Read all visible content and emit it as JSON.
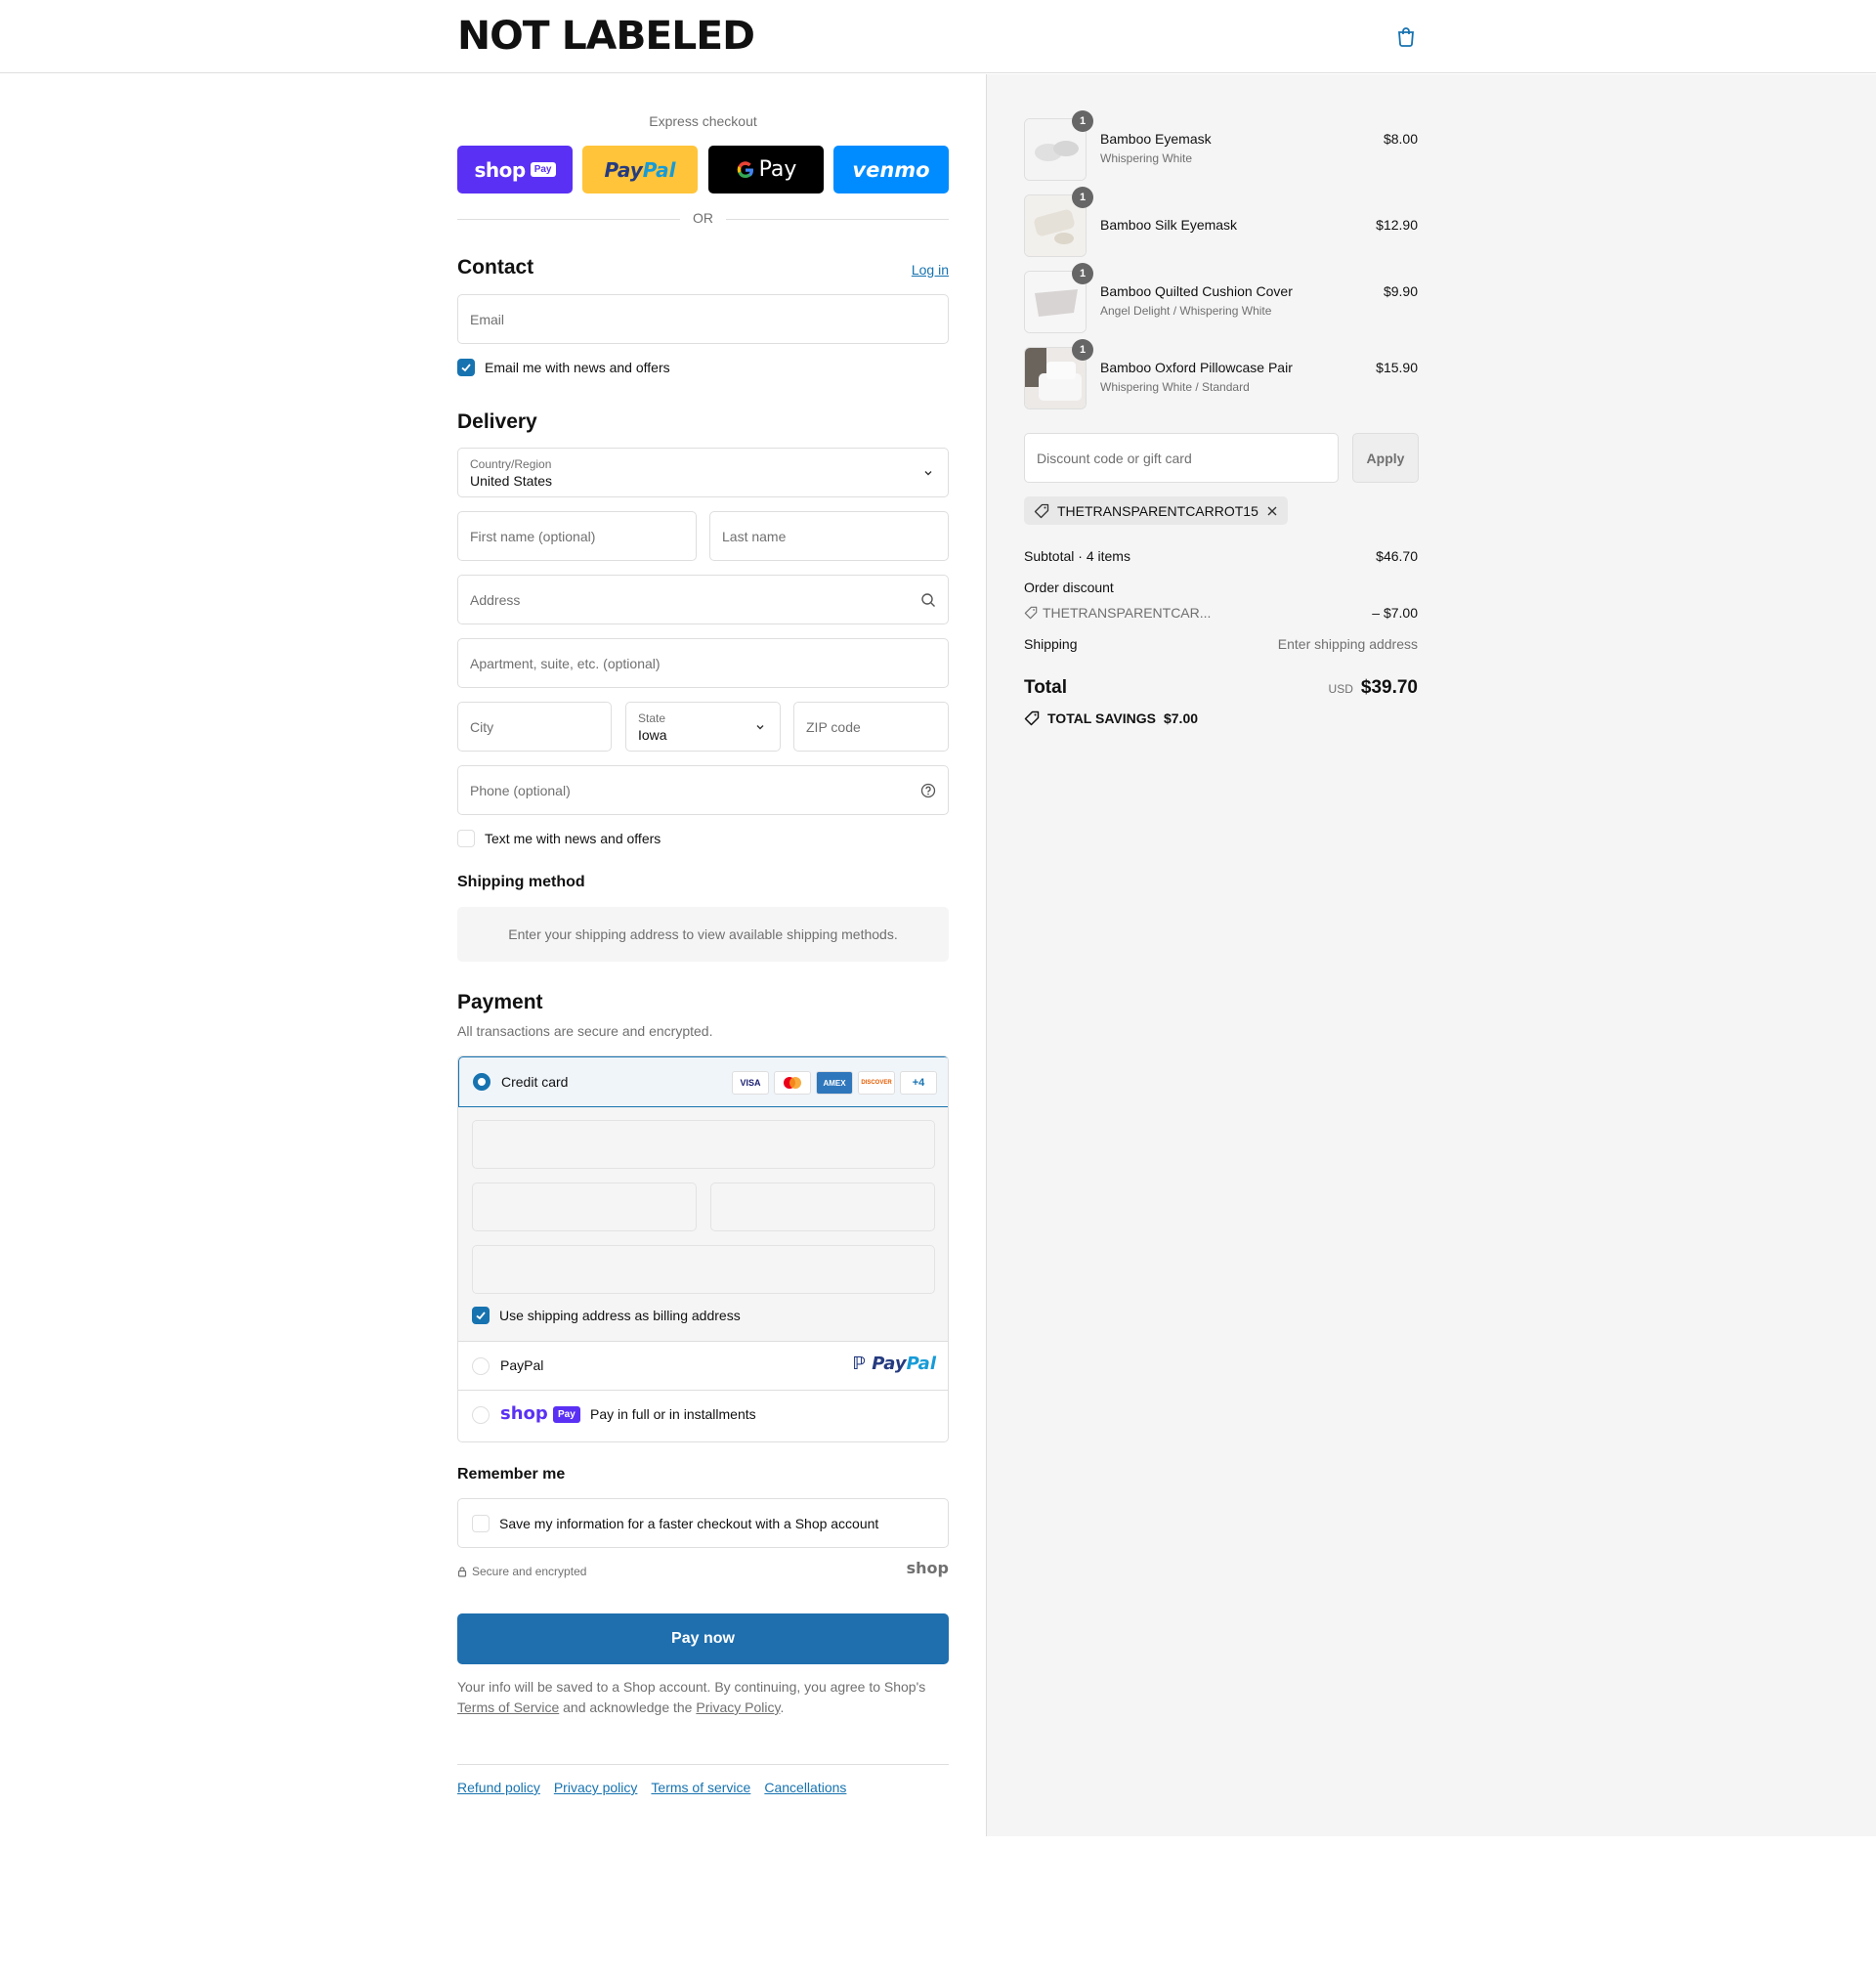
{
  "header": {
    "logo": "NOT LABELED"
  },
  "express": {
    "title": "Express checkout",
    "shop_pay": "shop",
    "shop_pay_badge": "Pay",
    "paypal_a": "Pay",
    "paypal_b": "Pal",
    "gpay": "Pay",
    "venmo": "venmo",
    "or": "OR"
  },
  "contact": {
    "title": "Contact",
    "login": "Log in",
    "email_placeholder": "Email",
    "news_label": "Email me with news and offers",
    "news_checked": true
  },
  "delivery": {
    "title": "Delivery",
    "country_label": "Country/Region",
    "country_value": "United States",
    "first_name": "First name (optional)",
    "last_name": "Last name",
    "address": "Address",
    "apartment": "Apartment, suite, etc. (optional)",
    "city": "City",
    "state_label": "State",
    "state_value": "Iowa",
    "zip": "ZIP code",
    "phone": "Phone (optional)",
    "text_label": "Text me with news and offers",
    "text_checked": false
  },
  "shipping_method": {
    "title": "Shipping method",
    "message": "Enter your shipping address to view available shipping methods."
  },
  "payment": {
    "title": "Payment",
    "subtitle": "All transactions are secure and encrypted.",
    "credit_card": "Credit card",
    "card_badges": [
      "VISA",
      "MC",
      "AMEX",
      "DISCOVER",
      "+4"
    ],
    "billing_label": "Use shipping address as billing address",
    "billing_checked": true,
    "paypal": "PayPal",
    "paypal_logo_a": "Pay",
    "paypal_logo_b": "Pal",
    "shop_logo": "shop",
    "shop_badge": "Pay",
    "shop_installments": "Pay in full or in installments"
  },
  "remember": {
    "title": "Remember me",
    "save_label": "Save my information for a faster checkout with a Shop account",
    "secure": "Secure and encrypted",
    "shop_mark": "shop"
  },
  "pay_now": "Pay now",
  "legal": {
    "text_1": "Your info will be saved to a Shop account. By continuing, you agree to Shop's",
    "terms": "Terms of Service",
    "text_2": "and acknowledge the",
    "privacy": "Privacy Policy",
    "text_3": "."
  },
  "footer": {
    "links": [
      "Refund policy",
      "Privacy policy",
      "Terms of service",
      "Cancellations"
    ]
  },
  "summary": {
    "items": [
      {
        "qty": "1",
        "name": "Bamboo Eyemask",
        "variant": "Whispering White",
        "price": "$8.00"
      },
      {
        "qty": "1",
        "name": "Bamboo Silk Eyemask",
        "variant": "",
        "price": "$12.90"
      },
      {
        "qty": "1",
        "name": "Bamboo Quilted Cushion Cover",
        "variant": "Angel Delight / Whispering White",
        "price": "$9.90"
      },
      {
        "qty": "1",
        "name": "Bamboo Oxford Pillowcase Pair",
        "variant": "Whispering White / Standard",
        "price": "$15.90"
      }
    ],
    "discount_placeholder": "Discount code or gift card",
    "apply": "Apply",
    "applied_code": "THETRANSPARENTCARROT15",
    "subtotal_label": "Subtotal · 4 items",
    "subtotal_value": "$46.70",
    "order_discount_label": "Order discount",
    "discount_code_short": "THETRANSPARENTCAR...",
    "discount_value": "– $7.00",
    "shipping_label": "Shipping",
    "shipping_value": "Enter shipping address",
    "total_label": "Total",
    "currency": "USD",
    "total_value": "$39.70",
    "savings_label": "TOTAL SAVINGS",
    "savings_value": "$7.00"
  },
  "colors": {
    "accent": "#1773b0",
    "pay_button": "#1f6fae",
    "shop_purple": "#5a31f4",
    "paypal_yellow": "#ffc439",
    "venmo_blue": "#008cff"
  }
}
